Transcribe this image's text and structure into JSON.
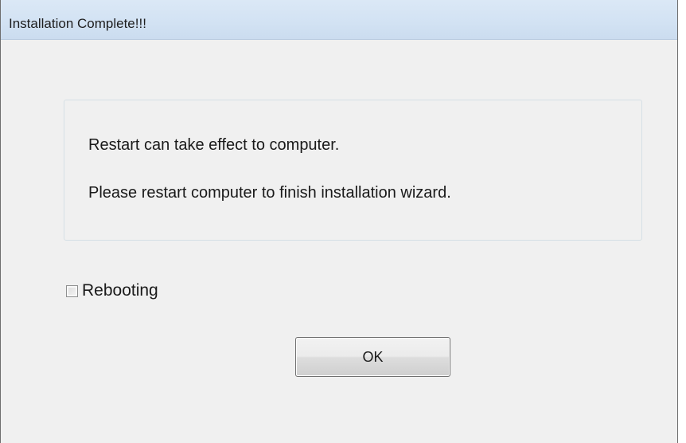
{
  "window": {
    "title": "Installation Complete!!!"
  },
  "message": {
    "line1": "Restart can take effect to computer.",
    "line2": "Please restart computer to finish installation wizard."
  },
  "reboot_option": {
    "label": "Rebooting",
    "checked": false
  },
  "buttons": {
    "ok_label": "OK"
  },
  "colors": {
    "titlebar": "#d2e2f3",
    "window_bg": "#f0f0f0",
    "panel_border": "#d5dfe5"
  }
}
